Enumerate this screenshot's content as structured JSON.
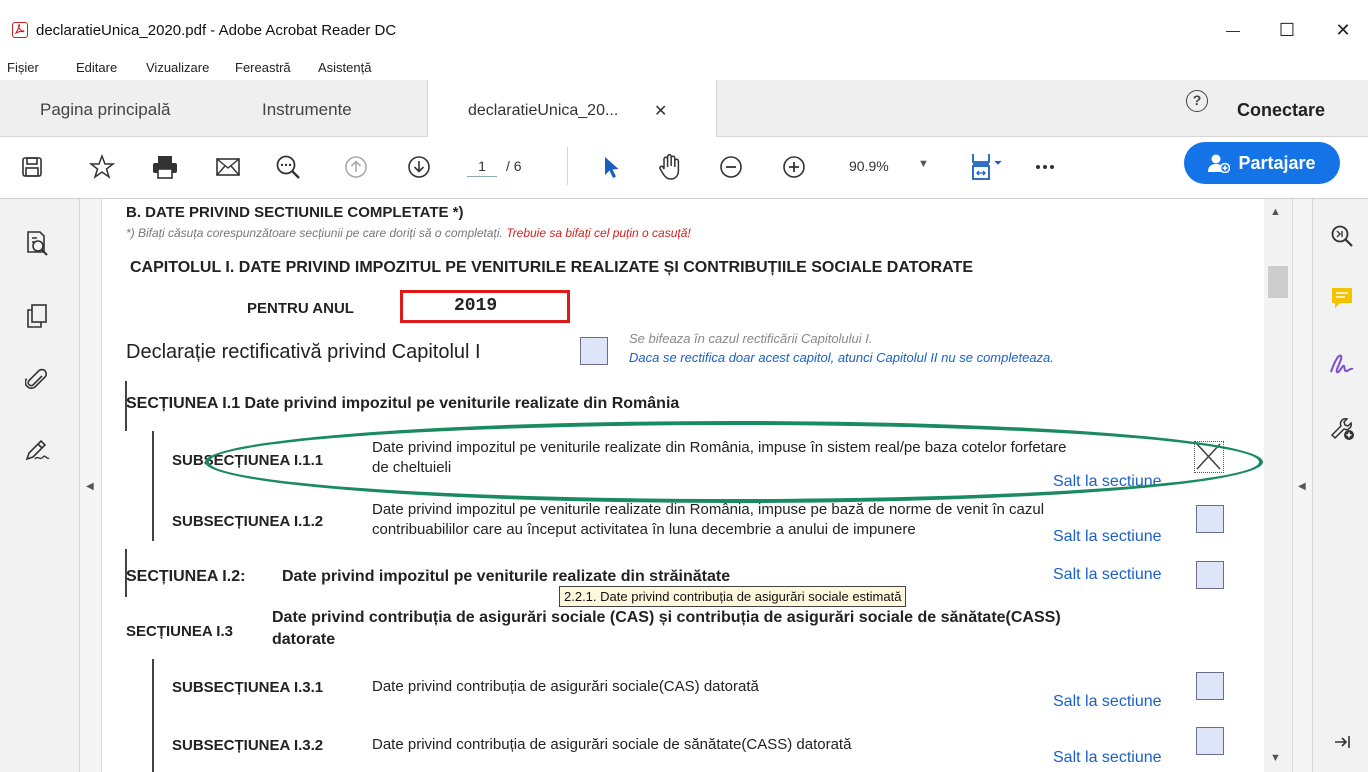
{
  "window": {
    "title": "declaratieUnica_2020.pdf - Adobe Acrobat Reader DC",
    "minimize": "—",
    "maximize": "☐",
    "close": "✕"
  },
  "menu": [
    "Fișier",
    "Editare",
    "Vizualizare",
    "Fereastră",
    "Asistență"
  ],
  "tabs": {
    "home": "Pagina principală",
    "tools": "Instrumente",
    "document": "declaratieUnica_20...",
    "document_close": "✕",
    "help": "?",
    "login": "Conectare"
  },
  "toolbar": {
    "page_current": "1",
    "page_total": "/ 6",
    "zoom": "90.9%",
    "zoom_caret": "▼",
    "share": "Partajare"
  },
  "document": {
    "section_b_title": "B. DATE PRIVIND SECTIUNILE COMPLETATE *)",
    "note_prefix": "*) Bifați căsuța corespunzătoare secțiunii pe care doriți să o completați. ",
    "note_required": "Trebuie sa bifați cel puțin o casuță!",
    "chapter1_title": "CAPITOLUL I. DATE PRIVIND IMPOZITUL PE VENITURILE REALIZATE ȘI CONTRIBUȚIILE SOCIALE DATORATE",
    "year_label": "PENTRU ANUL",
    "year_value": "2019",
    "rectification_label": "Declarație rectificativă privind Capitolul I",
    "rectification_note1": "Se bifeaza în cazul rectificării Capitolului I.",
    "rectification_note2": "Daca se rectifica doar acest capitol, atunci  Capitolul II  nu se completeaza.",
    "s1_1_title": "SECȚIUNEA I.1  Date privind impozitul pe veniturile realizate din România",
    "sub_1_1_1_label": "SUBSECȚIUNEA I.1.1",
    "sub_1_1_1_line1": "Date privind impozitul pe veniturile realizate din România, impuse în sistem real/pe baza cotelor forfetare",
    "sub_1_1_1_line2": "de cheltuieli",
    "sub_1_1_2_label": "SUBSECȚIUNEA I.1.2",
    "sub_1_1_2_line1": "Date privind impozitul pe veniturile realizate din România, impuse pe bază de norme de venit în cazul",
    "sub_1_1_2_line2": "contribuabililor care au început activitatea în luna decembrie a anului de impunere",
    "s1_2_label": "SECȚIUNEA I.2:",
    "s1_2_title": "Date privind impozitul pe veniturile realizate din străinătate",
    "s1_3_label": "SECȚIUNEA I.3",
    "s1_3_line1": "Date privind contribuția de asigurări sociale (CAS) și contribuția de asigurări sociale de sănătate(CASS)",
    "s1_3_line2": "datorate",
    "sub_1_3_1_label": "SUBSECȚIUNEA I.3.1",
    "sub_1_3_1_text": "Date privind contribuția de asigurări sociale(CAS) datorată",
    "sub_1_3_2_label": "SUBSECȚIUNEA I.3.2",
    "sub_1_3_2_text": "Date privind contribuția de asigurări sociale de sănătate(CASS) datorată",
    "jump_label": "Salt la sectiune",
    "tooltip": "2.2.1. Date privind contribuția de asigurări sociale estimată"
  },
  "colors": {
    "share_button": "#1473e6",
    "annotation_ellipse": "#1a8a60",
    "required_note": "#d61f1f",
    "year_box_border": "#e01818",
    "link": "#1a60c8"
  },
  "icons": [
    "save-icon",
    "bookmark-star-icon",
    "print-icon",
    "email-icon",
    "zoom-search-icon",
    "page-up-icon",
    "page-down-icon",
    "select-arrow-icon",
    "hand-tool-icon",
    "zoom-out-icon",
    "zoom-in-icon",
    "fit-page-icon",
    "more-icon",
    "share-person-icon"
  ]
}
